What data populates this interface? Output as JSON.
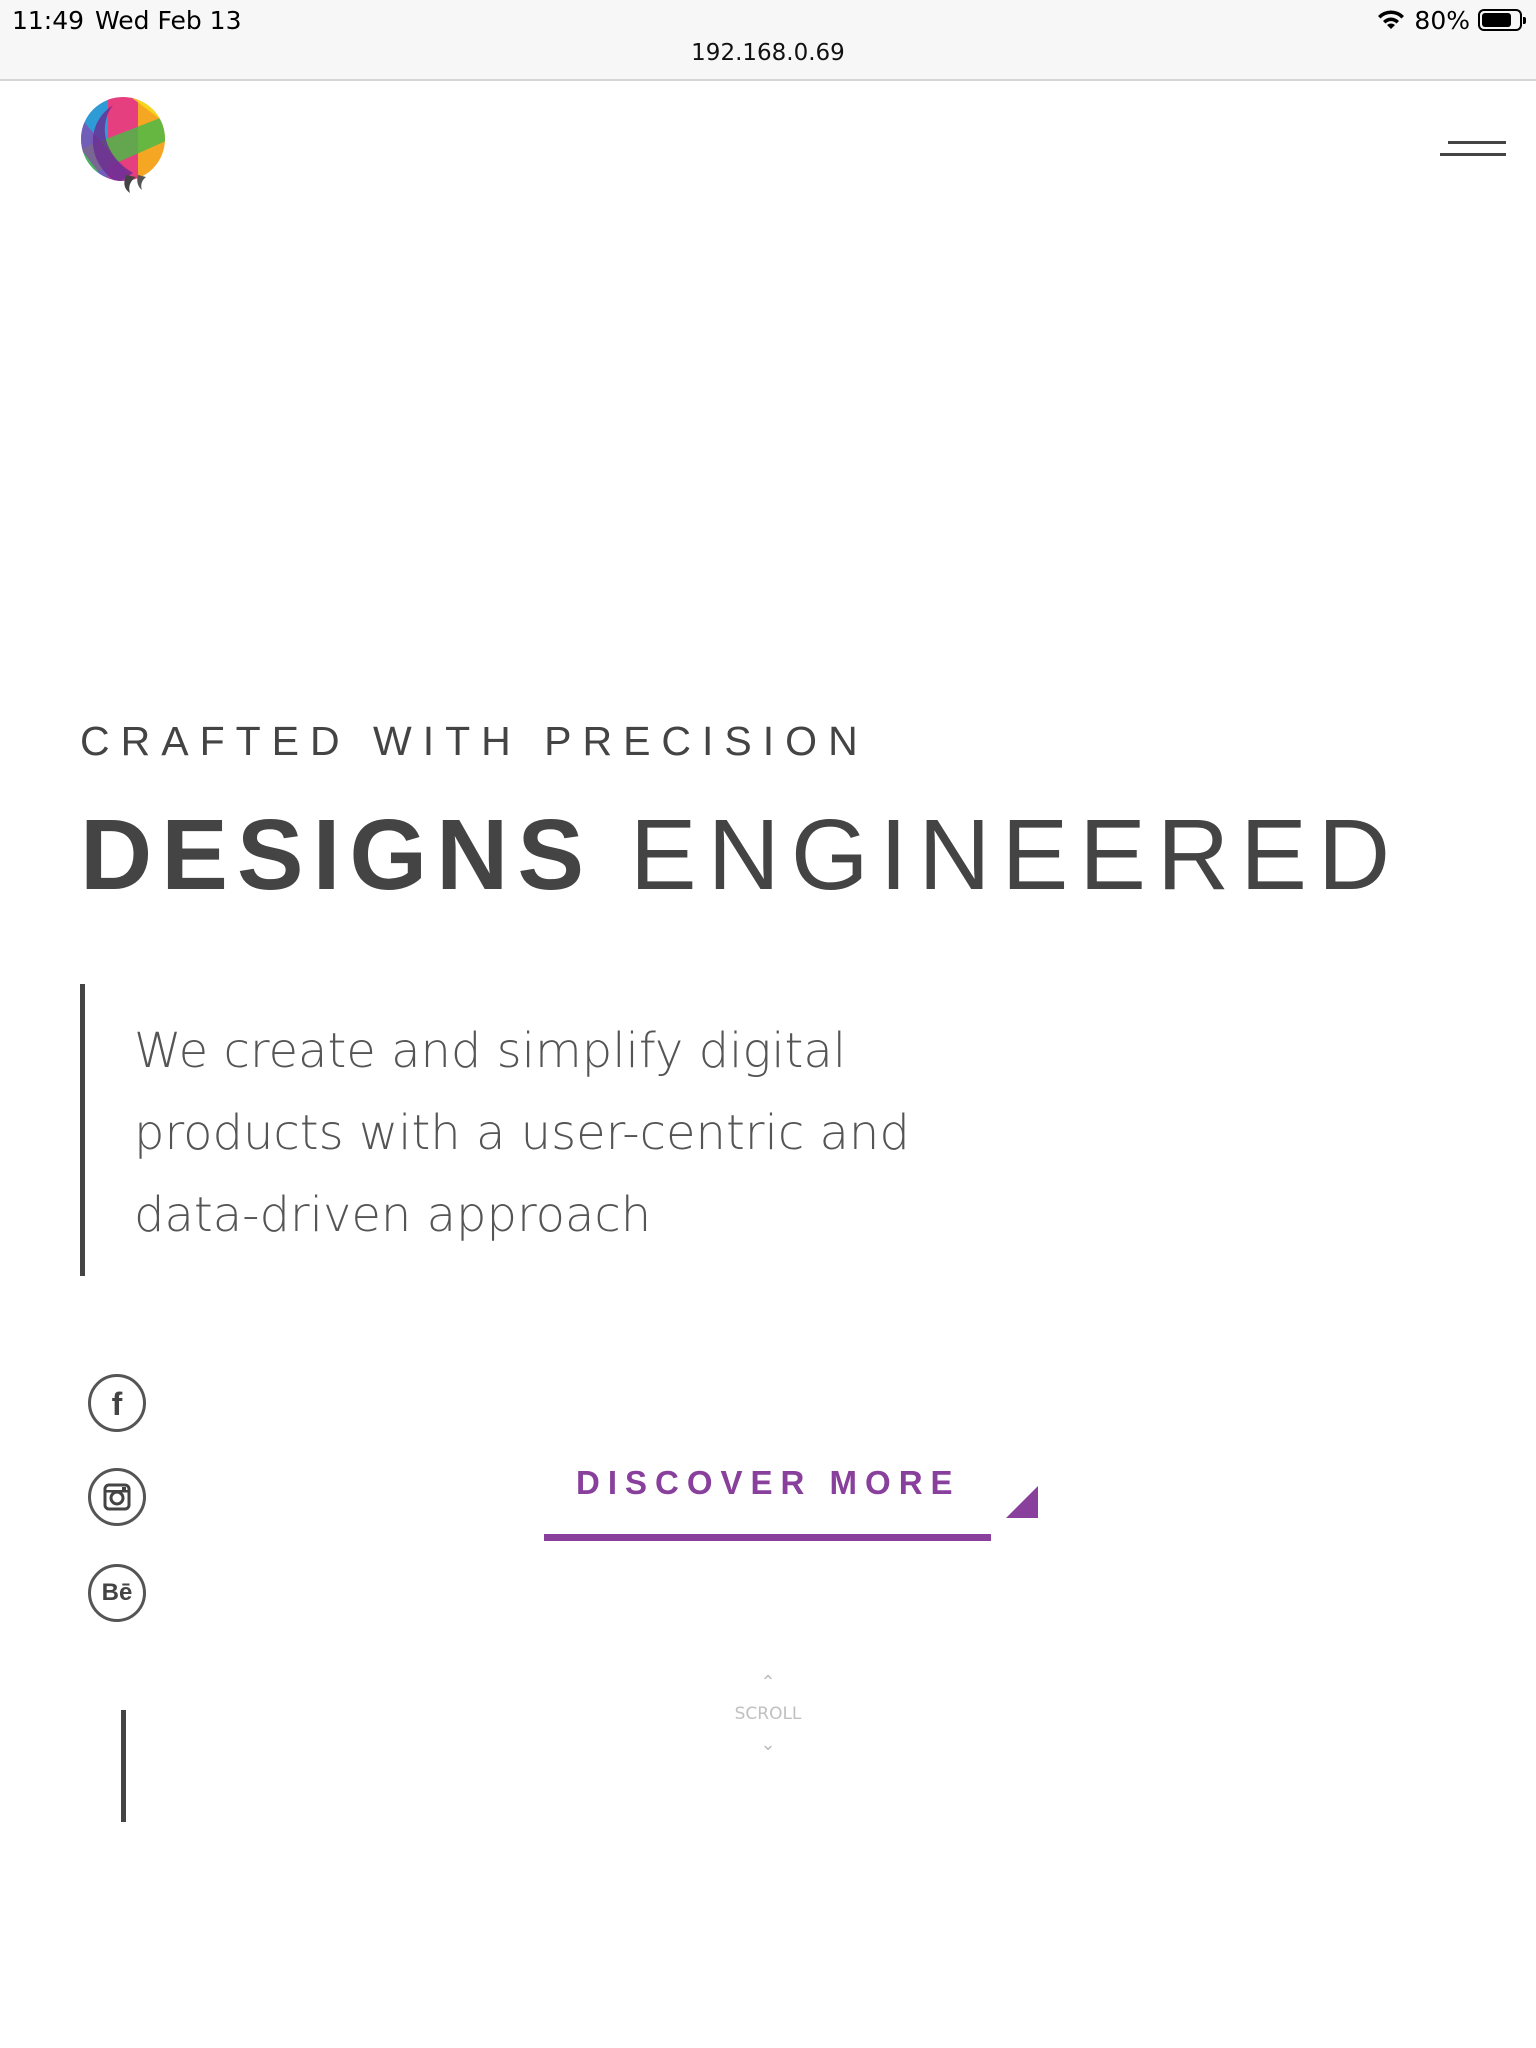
{
  "status_bar": {
    "time": "11:49",
    "date": "Wed Feb 13",
    "battery_text": "80%",
    "battery_level": 0.8
  },
  "browser": {
    "url": "192.168.0.69"
  },
  "header": {
    "logo_icon": "rainbow-balloon-logo",
    "menu_icon": "hamburger-menu-icon"
  },
  "hero": {
    "eyebrow": "CRAFTED WITH PRECISION",
    "headline_bold": "DESIGNS",
    "headline_light": "ENGINEERED",
    "quote_lines": [
      "We create and simplify digital",
      "products with a user-centric and",
      "data-driven approach"
    ]
  },
  "social": {
    "facebook_glyph": "f",
    "instagram_icon": "instagram-icon",
    "behance_glyph": "Bē"
  },
  "cta": {
    "label": "DISCOVER MORE",
    "color": "#893f9c"
  },
  "scroll": {
    "label": "SCROLL"
  },
  "colors": {
    "text": "#444444",
    "accent": "#893f9c"
  }
}
